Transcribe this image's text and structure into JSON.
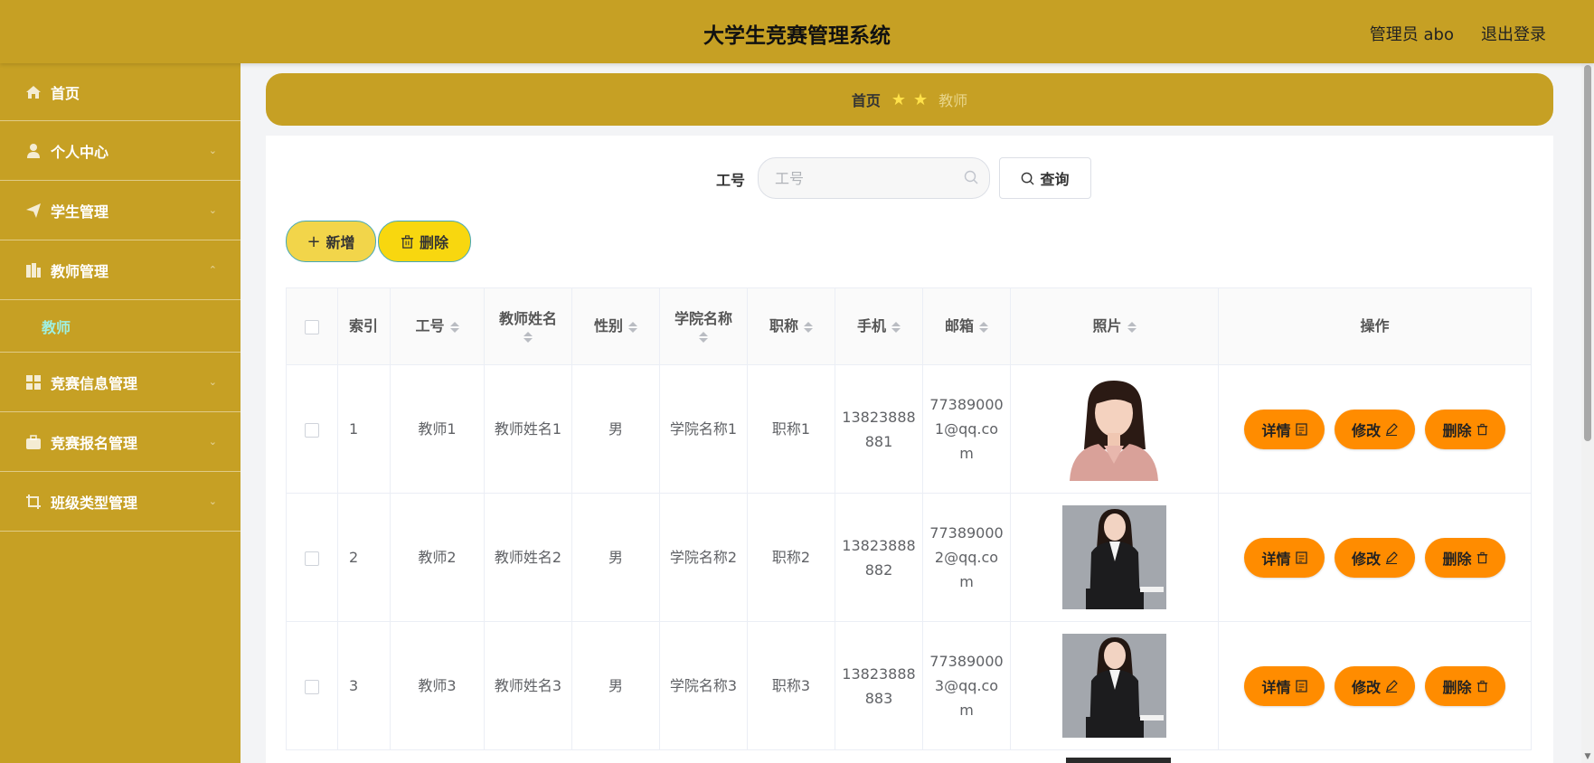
{
  "header": {
    "title": "大学生竞赛管理系统",
    "user": "管理员 abo",
    "logout": "退出登录"
  },
  "sidebar": {
    "items": [
      {
        "label": "首页",
        "icon": "home-icon"
      },
      {
        "label": "个人中心",
        "icon": "user-icon"
      },
      {
        "label": "学生管理",
        "icon": "send-icon"
      },
      {
        "label": "教师管理",
        "icon": "building-icon"
      },
      {
        "label": "竞赛信息管理",
        "icon": "grid-icon"
      },
      {
        "label": "竞赛报名管理",
        "icon": "briefcase-icon"
      },
      {
        "label": "班级类型管理",
        "icon": "crop-icon"
      }
    ],
    "submenu": {
      "label": "教师"
    }
  },
  "breadcrumb": {
    "home": "首页",
    "current": "教师"
  },
  "search": {
    "label": "工号",
    "placeholder": "工号",
    "button": "查询"
  },
  "actions": {
    "add": "新增",
    "delete": "删除"
  },
  "table": {
    "headers": {
      "index": "索引",
      "job_no": "工号",
      "name": "教师姓名",
      "gender": "性别",
      "college": "学院名称",
      "title": "职称",
      "phone": "手机",
      "email": "邮箱",
      "photo": "照片",
      "ops": "操作"
    },
    "rows": [
      {
        "index": "1",
        "job_no": "教师1",
        "name": "教师姓名1",
        "gender": "男",
        "college": "学院名称1",
        "title": "职称1",
        "phone": "13823888881",
        "email": "773890001@qq.com"
      },
      {
        "index": "2",
        "job_no": "教师2",
        "name": "教师姓名2",
        "gender": "男",
        "college": "学院名称2",
        "title": "职称2",
        "phone": "13823888882",
        "email": "773890002@qq.com"
      },
      {
        "index": "3",
        "job_no": "教师3",
        "name": "教师姓名3",
        "gender": "男",
        "college": "学院名称3",
        "title": "职称3",
        "phone": "13823888883",
        "email": "773890003@qq.com"
      }
    ],
    "row_buttons": {
      "detail": "详情",
      "edit": "修改",
      "delete": "删除"
    }
  },
  "colors": {
    "primary": "#c6a024",
    "action": "#ff8c00",
    "active_submenu": "#9ff0e2"
  }
}
